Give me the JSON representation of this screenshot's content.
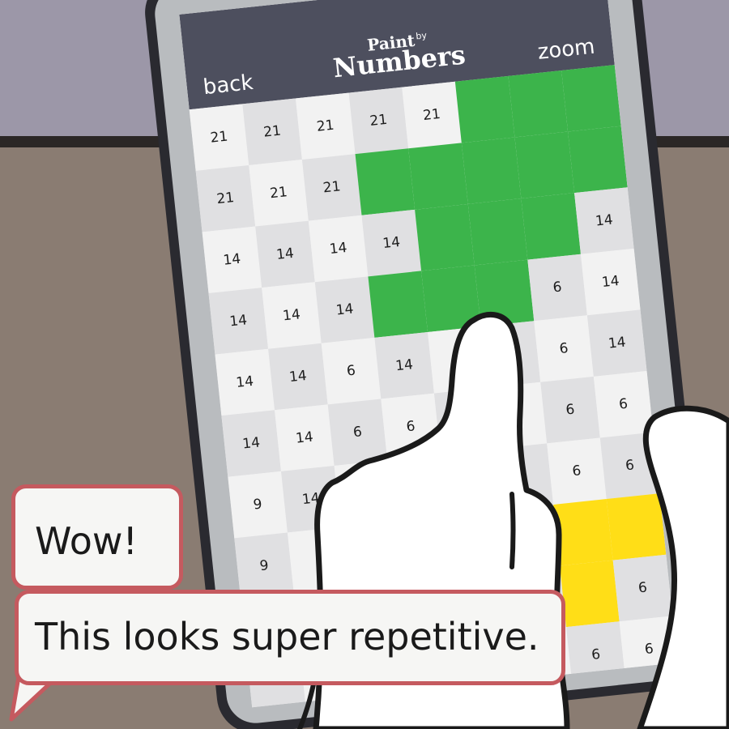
{
  "header": {
    "back_label": "back",
    "zoom_label": "zoom",
    "logo_line1": "Paint",
    "logo_by": "by",
    "logo_line2": "Numbers"
  },
  "palette": {
    "light": "#f2f2f2",
    "dark": "#e0e0e2",
    "green": "#3cb44b",
    "yellow": "#ffde17"
  },
  "grid": {
    "rows": [
      [
        "21",
        "21",
        "21",
        "21",
        "21",
        "G",
        "G",
        "G"
      ],
      [
        "21",
        "21",
        "21",
        "G",
        "G",
        "G",
        "G",
        "G"
      ],
      [
        "14",
        "14",
        "14",
        "14",
        "G",
        "G",
        "G",
        "14"
      ],
      [
        "14",
        "14",
        "14",
        "G",
        "G",
        "G",
        "6",
        "14"
      ],
      [
        "14",
        "14",
        "6",
        "14",
        "",
        "",
        "6",
        "14"
      ],
      [
        "14",
        "14",
        "6",
        "6",
        "",
        "",
        "6",
        "6"
      ],
      [
        "9",
        "14",
        "",
        "",
        "",
        "",
        "6",
        "6"
      ],
      [
        "9",
        "",
        "",
        "",
        "",
        "",
        "Y",
        "Y"
      ],
      [
        "",
        "",
        "",
        "",
        "",
        "",
        "Y",
        "6"
      ],
      [
        "",
        "",
        "",
        "",
        "",
        "",
        "6",
        "6"
      ]
    ]
  },
  "bubbles": {
    "first": "Wow!",
    "second": "This looks super repetitive."
  }
}
